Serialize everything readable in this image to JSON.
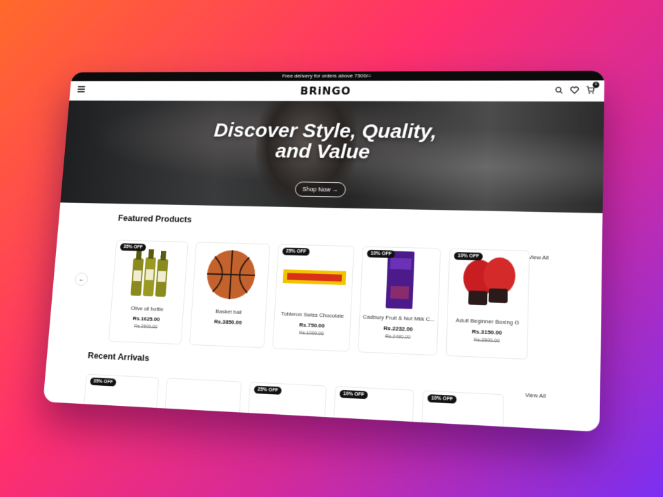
{
  "topbar": {
    "text": "Free delivery for orders above 7500/="
  },
  "header": {
    "logo": "BRiNGO",
    "cart_count": "0"
  },
  "icons": {
    "menu": "menu-icon",
    "search": "search-icon",
    "wishlist": "heart-icon",
    "cart": "cart-icon"
  },
  "hero": {
    "title_line1": "Discover Style, Quality,",
    "title_line2": "and Value",
    "cta": "Shop Now →"
  },
  "featured": {
    "title": "Featured Products",
    "view_all": "View All",
    "products": [
      {
        "name": "Olive oil bottle",
        "price": "Rs.1625.00",
        "old_price": "Rs.2500.00",
        "discount": "35% OFF"
      },
      {
        "name": "Basket ball",
        "price": "Rs.3850.00",
        "old_price": "",
        "discount": ""
      },
      {
        "name": "Tobleron Swiss Chocolate",
        "price": "Rs.750.00",
        "old_price": "Rs.1000.00",
        "discount": "25% OFF"
      },
      {
        "name": "Cadbury Fruit & Nut Milk C...",
        "price": "Rs.2232.00",
        "old_price": "Rs.2480.00",
        "discount": "10% OFF"
      },
      {
        "name": "Adult Beginner Boxing G",
        "price": "Rs.3150.00",
        "old_price": "Rs.3500.00",
        "discount": "10% OFF"
      }
    ],
    "prev": "←",
    "next": "→"
  },
  "recent": {
    "title": "Recent Arrivals",
    "view_all": "View All",
    "badges": [
      "35% OFF",
      "",
      "25% OFF",
      "10% OFF",
      "10% OFF"
    ]
  },
  "colors": {
    "accent": "#111111",
    "background": "#ffffff"
  }
}
